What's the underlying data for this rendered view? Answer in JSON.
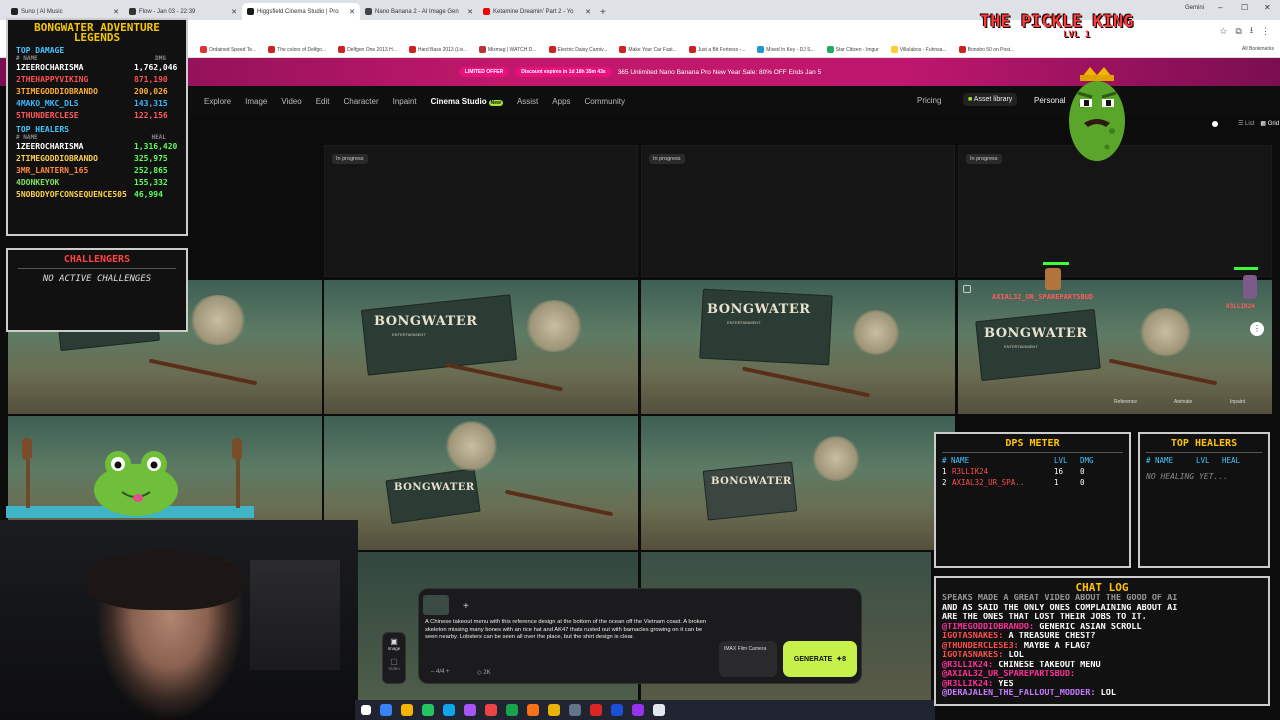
{
  "browser": {
    "tabs": [
      {
        "title": "Suno | AI Music",
        "color": "#222"
      },
      {
        "title": "Flow - Jan 03 - 22:39",
        "color": "#333"
      },
      {
        "title": "Higgsfield Cinema Studio | Pro",
        "color": "#1a1a1a",
        "active": true
      },
      {
        "title": "Nano Banana 2 - AI Image Gen",
        "color": "#444"
      },
      {
        "title": "Ketamine Dreamin' Part 2 - Yo",
        "color": "#e00"
      }
    ],
    "new_tab": "+",
    "gemini": "Gemini",
    "bookmarks": [
      "Ordained Speed Te...",
      "The colors of Delfgo...",
      "Delfgon One 2013 H...",
      "Hard Bass 2013 (Liv...",
      "Mixmag | WATCH D...",
      "Electric Daisy Carniv...",
      "Make Your Car Fast...",
      "Just a Bit Fortress -...",
      "Mixed In Key - DJ S...",
      "Star Citizen - Imgur",
      "VillaIabos - Fuhnsa...",
      "Bonobo 50 on Post..."
    ],
    "all_bookmarks": "All Bookmarks"
  },
  "promo": {
    "badge1": "LIMITED OFFER",
    "badge2": "Discount expires in 1d 18h 35m 43s",
    "text": "365 Unlimited Nano Banana Pro New Year Sale: 80% OFF Ends Jan 5"
  },
  "nav": {
    "items": [
      "Explore",
      "Image",
      "Video",
      "Edit",
      "Character",
      "Inpaint"
    ],
    "active": "Cinema Studio",
    "new_badge": "New",
    "items2": [
      "Assist",
      "Apps",
      "Community"
    ],
    "pricing": "Pricing",
    "asset_library": "Asset library",
    "personal": "Personal",
    "view_list": "List",
    "view_grid": "Grid"
  },
  "grid": {
    "in_progress": "In progress",
    "flag_title": "BONGWATER",
    "flag_sub": "ENTERTAINMENT",
    "flag_tag": "REACHING FOR THE SKY AND HITTING THE CLOUD",
    "hover_actions": [
      "Reference",
      "Animate",
      "Inpaint"
    ]
  },
  "leaderboard": {
    "title_line1": "BONGWATER ADVENTURE",
    "title_line2": "LEGENDS",
    "damage_title": "TOP DAMAGE",
    "damage_head_name": "# NAME",
    "damage_head_val": "DMG",
    "damage": [
      {
        "rank": "1",
        "name": "ZEEROCHARISMA",
        "val": "1,762,046"
      },
      {
        "rank": "2",
        "name": "THEHAPPYVIKING",
        "val": "871,190"
      },
      {
        "rank": "3",
        "name": "TIMEGODDIOBRANDO",
        "val": "200,026"
      },
      {
        "rank": "4",
        "name": "MAKO_MKC_DLS",
        "val": "143,315"
      },
      {
        "rank": "5",
        "name": "THUNDERCLESE",
        "val": "122,156"
      }
    ],
    "healers_title": "TOP HEALERS",
    "healers_head_name": "# NAME",
    "healers_head_val": "HEAL",
    "healers": [
      {
        "rank": "1",
        "name": "ZEEROCHARISMA",
        "val": "1,316,420"
      },
      {
        "rank": "2",
        "name": "TIMEGODDIOBRANDO",
        "val": "325,975"
      },
      {
        "rank": "3",
        "name": "MR_LANTERN_165",
        "val": "252,865"
      },
      {
        "rank": "4",
        "name": "DONKEYOK",
        "val": "155,332"
      },
      {
        "rank": "5",
        "name": "NOBODYOFCONSEQUENCE505",
        "val": "46,994"
      }
    ]
  },
  "challenges": {
    "title": "CHALLENGERS",
    "body": "NO ACTIVE CHALLENGES"
  },
  "pickle": {
    "title": "THE PICKLE KING",
    "level": "LVL 1"
  },
  "players": {
    "p1": "AXIAL32_UR_SPAREPARTSBUD",
    "p2": "R3LLIK24"
  },
  "dps": {
    "title": "DPS METER",
    "head": [
      "# NAME",
      "LVL",
      "DMG"
    ],
    "rows": [
      {
        "rank": "1",
        "name": "R3LLIK24",
        "lvl": "16",
        "dmg": "0"
      },
      {
        "rank": "2",
        "name": "AXIAL32_UR_SPA..",
        "lvl": "1",
        "dmg": "0"
      }
    ]
  },
  "top_healers": {
    "title": "TOP HEALERS",
    "head": [
      "# NAME",
      "LVL",
      "HEAL"
    ],
    "empty": "NO HEALING YET..."
  },
  "chat": {
    "title": "CHAT LOG",
    "lines": [
      {
        "user": "",
        "msg": "SPEAKS MADE A GREAT VIDEO ABOUT THE GOOD OF AI"
      },
      {
        "user": "",
        "msg": "AND AS SAID THE ONLY ONES COMPLAINING ABOUT AI"
      },
      {
        "user": "",
        "msg": "ARE THE ONES THAT LOST THEIR JOBS TO IT."
      },
      {
        "user": "@TIMEGODDIOBRANDO:",
        "msg": " GENERIC ASIAN SCROLL"
      },
      {
        "user": "IGOTASNAKES:",
        "msg": " A TREASURE CHEST?"
      },
      {
        "user": "@THUNDERCLESE3:",
        "msg": " MAYBE A FLAG?"
      },
      {
        "user": "IGOTASNAKES:",
        "msg": " LOL"
      },
      {
        "user": "@R3LLIK24:",
        "msg": " CHINESE TAKEOUT MENU"
      },
      {
        "user": "@AXIAL32_UR_SPAREPARTSBUD:",
        "msg": ""
      },
      {
        "user": "@R3LLIK24:",
        "msg": " YES"
      },
      {
        "user": "@DERAJALEN_THE_FALLOUT_MODDER:",
        "msg": " LOL"
      }
    ]
  },
  "prompt": {
    "text": "A Chinese takeout menu with this reference design at the bottom of the ocean off the Vietnam coast. A broken skeleton missing many bones with an rice hat and AK47 thats rusted out with barnacles growing on it can be seen nearby. Lobsters can be seen all over the place, but the shirt design is clear.",
    "count": "4/4",
    "resolution": "2K",
    "camera": "IMAX Film Camera",
    "generate": "GENERATE",
    "credits": "8",
    "mode_image": "Image",
    "mode_video": "Video"
  }
}
